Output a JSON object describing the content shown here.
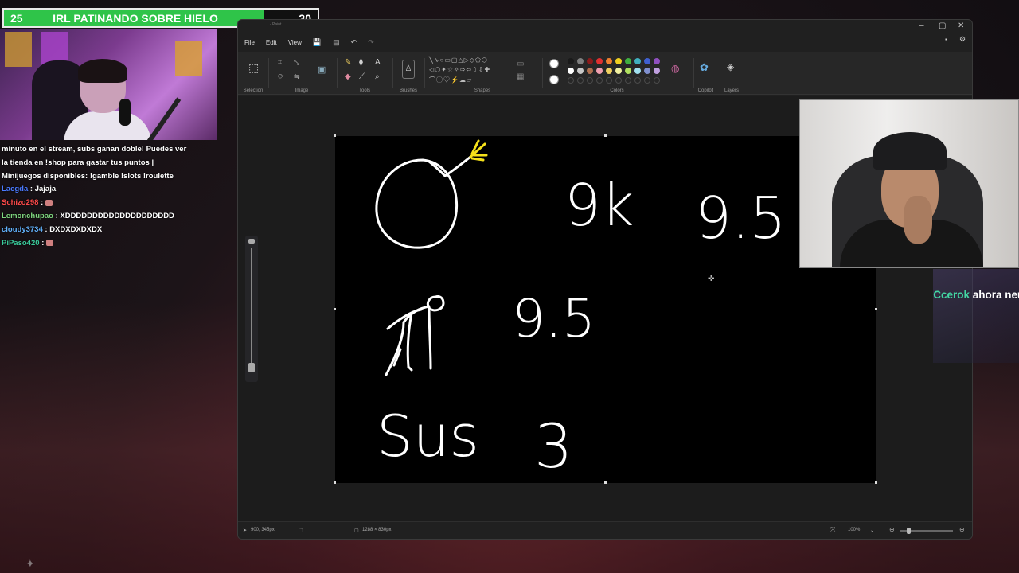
{
  "goal": {
    "start": "25",
    "title": "IRL PATINANDO SOBRE HIELO",
    "end": "30",
    "fill_fraction": 0.83,
    "fill_color": "#2fc449"
  },
  "chat": {
    "lines": [
      {
        "user": "",
        "text": "minuto en el stream, subs ganan doble! Puedes ver"
      },
      {
        "user": "",
        "text": "la tienda en !shop para gastar tus puntos |"
      },
      {
        "user": "",
        "text": "Minijuegos disponibles: !gamble !slots !roulette"
      },
      {
        "user": "Lacgda",
        "user_color": "#4a7aff",
        "text": ": Jajaja"
      },
      {
        "user": "Schizo298",
        "user_color": "#ff4a4a",
        "text": ":"
      },
      {
        "user": "Lemonchupao",
        "user_color": "#7fd67f",
        "text": ": XDDDDDDDDDDDDDDDDDDDD"
      },
      {
        "user": "cloudy3734",
        "user_color": "#63b4ff",
        "text": ": DXDXDXDXDX"
      },
      {
        "user": "PiPaso420",
        "user_color": "#3ac99a",
        "text": ":"
      }
    ]
  },
  "paint": {
    "title": "- Paint",
    "menu": {
      "file": "File",
      "edit": "Edit",
      "view": "View"
    },
    "ribbon": {
      "selection": "Selection",
      "image": "Image",
      "tools": "Tools",
      "brushes": "Brushes",
      "shapes": "Shapes",
      "colors": "Colors",
      "copilot": "Copilot",
      "layers": "Layers"
    },
    "palette": [
      "#1a1a1a",
      "#7f7f7f",
      "#8b1a1a",
      "#e03030",
      "#f08030",
      "#f0d020",
      "#40b040",
      "#40b0c0",
      "#4060d0",
      "#9050c0",
      "#ffffff",
      "#c8c8c8",
      "#b07050",
      "#f0a0b0",
      "#f0d060",
      "#f0f0a0",
      "#b0e060",
      "#a0e0f0",
      "#8090d0",
      "#c0a0e0"
    ],
    "status": {
      "cursor": "900, 345px",
      "canvas_size": "1288 × 830px",
      "zoom": "100%"
    }
  },
  "drawing": {
    "labels": {
      "row1_a": "9k",
      "row1_b": "9.5",
      "row2": "9.5",
      "row3_word": "Sus",
      "row3_num": "3"
    },
    "fuse_spark_color": "#f5e11a"
  },
  "alert": {
    "user": "Ccerok",
    "message": "ahora neutral!"
  }
}
